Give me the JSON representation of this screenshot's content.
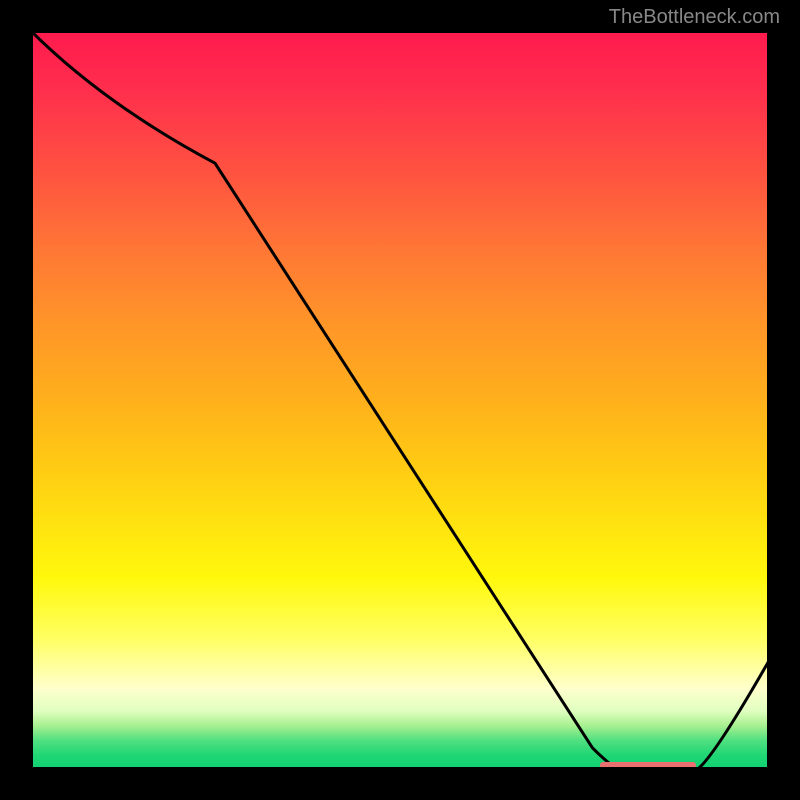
{
  "watermark": "TheBottleneck.com",
  "chart_data": {
    "type": "line",
    "title": "",
    "xlabel": "",
    "ylabel": "",
    "xlim": [
      0,
      100
    ],
    "ylim": [
      0,
      100
    ],
    "x": [
      0,
      5,
      25,
      80,
      90,
      100
    ],
    "values": [
      100,
      95,
      82,
      0,
      0,
      15
    ],
    "optimum_range": [
      77,
      90
    ],
    "gradient_colors": {
      "top": "#ff1a4d",
      "middle": "#ffe010",
      "bottom": "#0ed070"
    }
  }
}
